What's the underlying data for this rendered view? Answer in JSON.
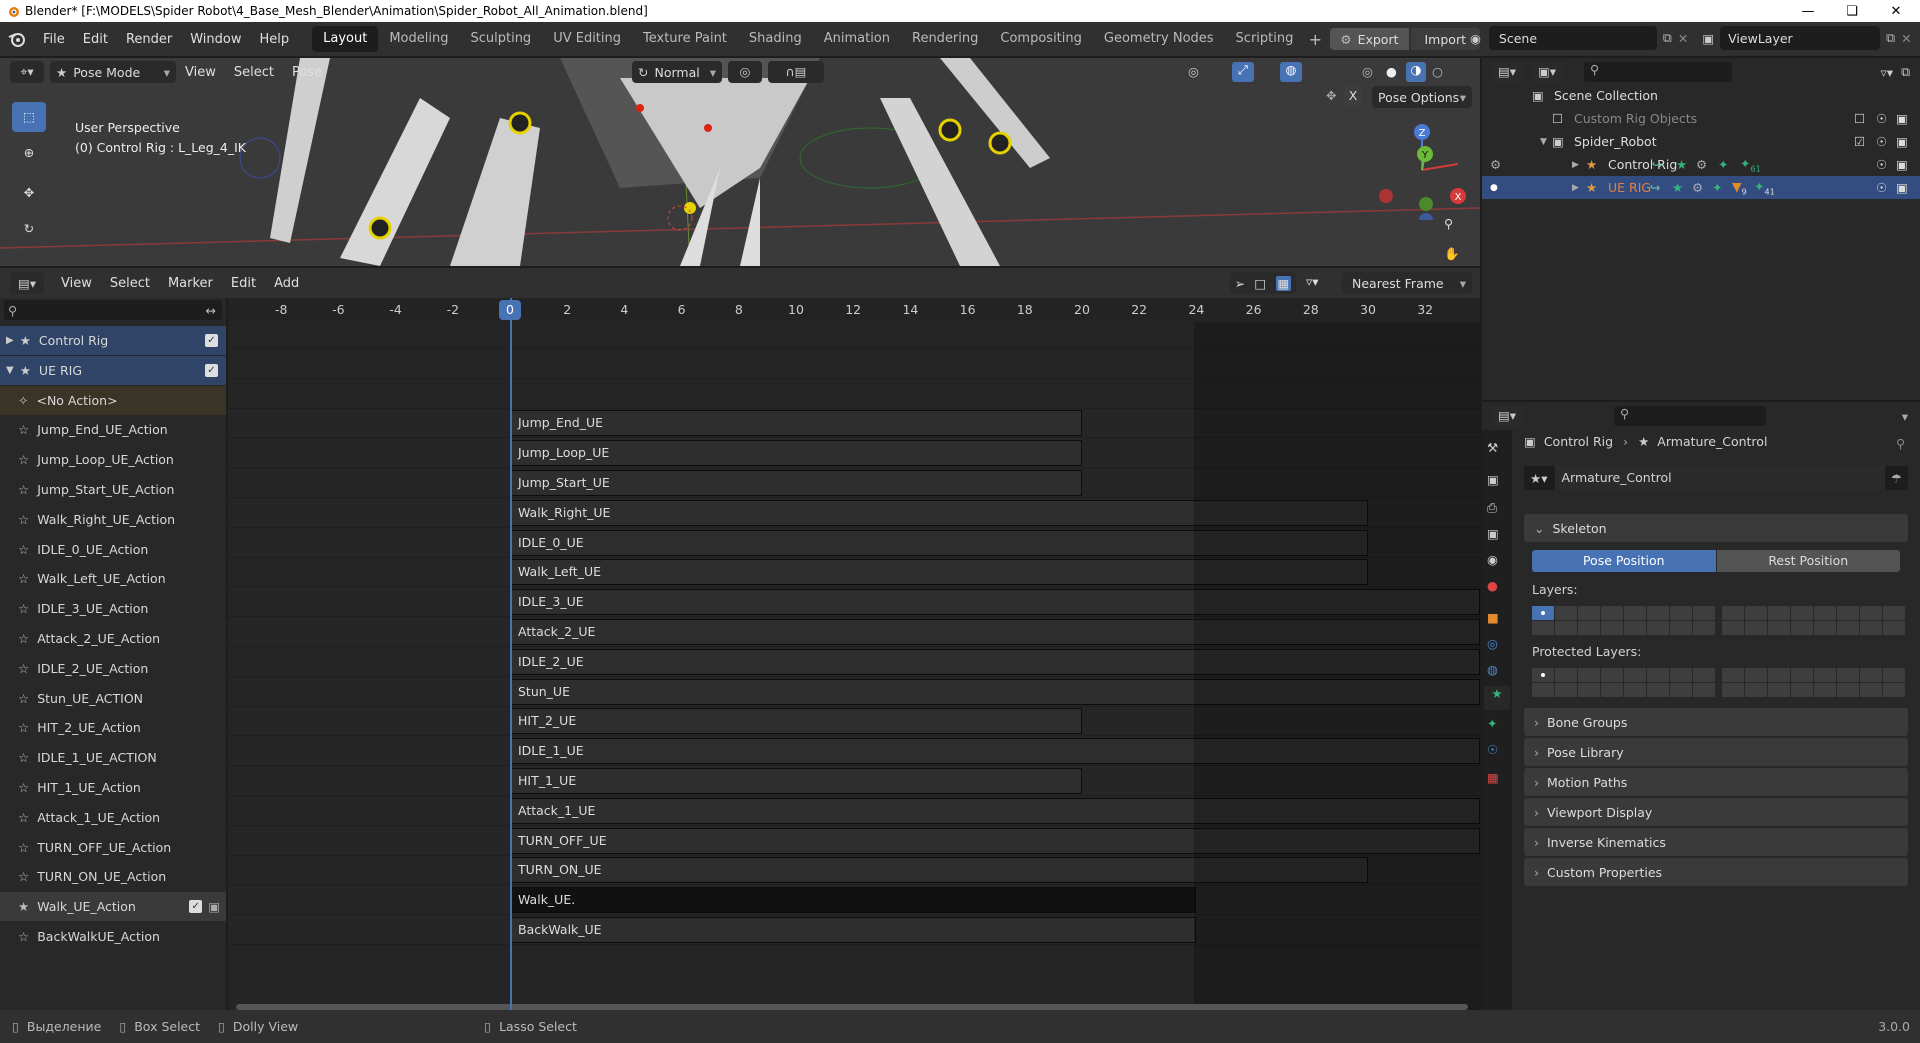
{
  "window": {
    "title": "Blender* [F:\\MODELS\\Spider Robot\\4_Base_Mesh_Blender\\Animation\\Spider_Robot_All_Animation.blend]"
  },
  "menus": [
    "File",
    "Edit",
    "Render",
    "Window",
    "Help"
  ],
  "workspaces": [
    "Layout",
    "Modeling",
    "Sculpting",
    "UV Editing",
    "Texture Paint",
    "Shading",
    "Animation",
    "Rendering",
    "Compositing",
    "Geometry Nodes",
    "Scripting"
  ],
  "active_workspace": "Layout",
  "export_label": "Export",
  "import_label": "Import",
  "scene_name": "Scene",
  "viewlayer_name": "ViewLayer",
  "viewport": {
    "mode": "Pose Mode",
    "menus": [
      "View",
      "Select",
      "Pose"
    ],
    "orientation": "Normal",
    "pose_options": "Pose Options",
    "perspective": "User Perspective",
    "active_object": "(0) Control Rig : L_Leg_4_IK",
    "x_label": "X",
    "gizmo": {
      "x": "X",
      "y": "Y",
      "z": "Z"
    }
  },
  "dopesheet": {
    "menus": [
      "View",
      "Select",
      "Marker",
      "Edit",
      "Add"
    ],
    "snap": "Nearest Frame",
    "current_frame": "0",
    "ticks": [
      "-8",
      "-6",
      "-4",
      "-2",
      "0",
      "2",
      "4",
      "6",
      "8",
      "10",
      "12",
      "14",
      "16",
      "18",
      "20",
      "22",
      "24",
      "26",
      "28",
      "30",
      "32"
    ],
    "channels": [
      {
        "label": "Control Rig",
        "type": "object"
      },
      {
        "label": "UE RIG",
        "type": "object"
      },
      {
        "label": "<No Action>",
        "type": "noaction"
      },
      {
        "label": "Jump_End_UE_Action",
        "type": "track"
      },
      {
        "label": "Jump_Loop_UE_Action",
        "type": "track"
      },
      {
        "label": "Jump_Start_UE_Action",
        "type": "track"
      },
      {
        "label": "Walk_Right_UE_Action",
        "type": "track"
      },
      {
        "label": "IDLE_0_UE_Action",
        "type": "track"
      },
      {
        "label": "Walk_Left_UE_Action",
        "type": "track"
      },
      {
        "label": "IDLE_3_UE_Action",
        "type": "track"
      },
      {
        "label": "Attack_2_UE_Action",
        "type": "track"
      },
      {
        "label": "IDLE_2_UE_Action",
        "type": "track"
      },
      {
        "label": "Stun_UE_ACTION",
        "type": "track"
      },
      {
        "label": "HIT_2_UE_Action",
        "type": "track"
      },
      {
        "label": "IDLE_1_UE_ACTION",
        "type": "track"
      },
      {
        "label": "HIT_1_UE_Action",
        "type": "track"
      },
      {
        "label": "Attack_1_UE_Action",
        "type": "track"
      },
      {
        "label": "TURN_OFF_UE_Action",
        "type": "track"
      },
      {
        "label": "TURN_ON_UE_Action",
        "type": "track"
      },
      {
        "label": "Walk_UE_Action",
        "type": "track"
      },
      {
        "label": "BackWalkUE_Action",
        "type": "track"
      }
    ],
    "strips": [
      {
        "label": "Jump_End_UE",
        "start": 0,
        "end": 20
      },
      {
        "label": "Jump_Loop_UE",
        "start": 0,
        "end": 20
      },
      {
        "label": "Jump_Start_UE",
        "start": 0,
        "end": 20
      },
      {
        "label": "Walk_Right_UE",
        "start": 0,
        "end": 30
      },
      {
        "label": "IDLE_0_UE",
        "start": 0,
        "end": 30
      },
      {
        "label": "Walk_Left_UE",
        "start": 0,
        "end": 30
      },
      {
        "label": "IDLE_3_UE",
        "start": 0,
        "end": 40
      },
      {
        "label": "Attack_2_UE",
        "start": 0,
        "end": 40
      },
      {
        "label": "IDLE_2_UE",
        "start": 0,
        "end": 40
      },
      {
        "label": "Stun_UE",
        "start": 0,
        "end": 40
      },
      {
        "label": "HIT_2_UE",
        "start": 0,
        "end": 20
      },
      {
        "label": "IDLE_1_UE",
        "start": 0,
        "end": 40
      },
      {
        "label": "HIT_1_UE",
        "start": 0,
        "end": 20
      },
      {
        "label": "Attack_1_UE",
        "start": 0,
        "end": 40
      },
      {
        "label": "TURN_OFF_UE",
        "start": 0,
        "end": 40
      },
      {
        "label": "TURN_ON_UE",
        "start": 0,
        "end": 30
      },
      {
        "label": "Walk_UE.",
        "start": 0,
        "end": 24
      },
      {
        "label": "BackWalk_UE",
        "start": 0,
        "end": 24
      }
    ]
  },
  "outliner": {
    "rows": [
      {
        "label": "Scene Collection",
        "indent": 0
      },
      {
        "label": "Custom Rig Objects",
        "indent": 1
      },
      {
        "label": "Spider_Robot",
        "indent": 1
      },
      {
        "label": "Control Rig",
        "indent": 2
      },
      {
        "label": "UE RIG",
        "indent": 2
      }
    ],
    "badges": {
      "control_rig": "61",
      "ue_rig_a": "9",
      "ue_rig_b": "41"
    }
  },
  "properties": {
    "breadcrumb_object": "Control Rig",
    "breadcrumb_data": "Armature_Control",
    "data_name": "Armature_Control",
    "skeleton_label": "Skeleton",
    "pose_position": "Pose Position",
    "rest_position": "Rest Position",
    "layers_label": "Layers:",
    "protected_layers_label": "Protected Layers:",
    "panels": [
      "Bone Groups",
      "Pose Library",
      "Motion Paths",
      "Viewport Display",
      "Inverse Kinematics",
      "Custom Properties"
    ]
  },
  "statusbar": {
    "items": [
      "Выделение",
      "Box Select",
      "Dolly View",
      "Lasso Select"
    ],
    "version": "3.0.0"
  },
  "colors": {
    "accent": "#4772b3",
    "selected_row": "#334d80",
    "playhead": "#4772b3"
  }
}
